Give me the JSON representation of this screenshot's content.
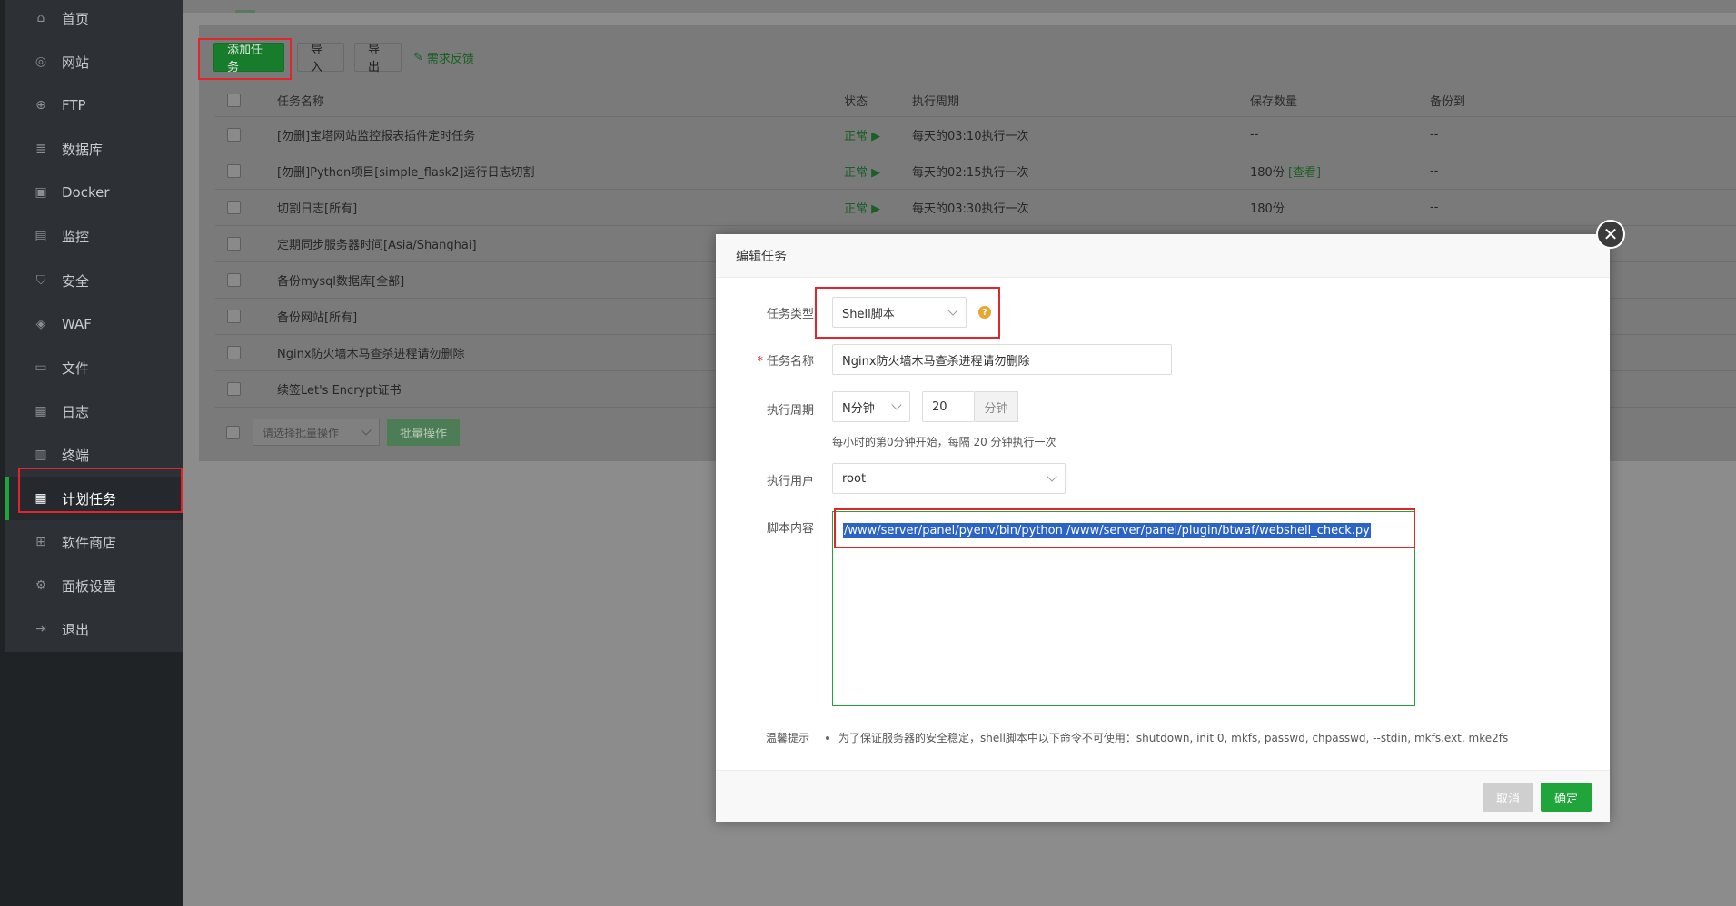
{
  "sidebar": {
    "items": [
      {
        "label": "首页",
        "icon": "home-icon"
      },
      {
        "label": "网站",
        "icon": "globe-icon"
      },
      {
        "label": "FTP",
        "icon": "ftp-icon"
      },
      {
        "label": "数据库",
        "icon": "database-icon"
      },
      {
        "label": "Docker",
        "icon": "docker-icon"
      },
      {
        "label": "监控",
        "icon": "monitor-icon"
      },
      {
        "label": "安全",
        "icon": "shield-icon"
      },
      {
        "label": "WAF",
        "icon": "waf-icon"
      },
      {
        "label": "文件",
        "icon": "folder-icon"
      },
      {
        "label": "日志",
        "icon": "log-icon"
      },
      {
        "label": "终端",
        "icon": "terminal-icon"
      },
      {
        "label": "计划任务",
        "icon": "calendar-icon"
      },
      {
        "label": "软件商店",
        "icon": "store-icon"
      },
      {
        "label": "面板设置",
        "icon": "gear-icon"
      },
      {
        "label": "退出",
        "icon": "logout-icon"
      }
    ],
    "active_index": 11
  },
  "toolbar": {
    "add_task": "添加任务",
    "import": "导入",
    "export": "导出",
    "feedback": "需求反馈"
  },
  "table": {
    "headers": {
      "name": "任务名称",
      "status": "状态",
      "cycle": "执行周期",
      "keep": "保存数量",
      "backup": "备份到"
    },
    "rows": [
      {
        "name": "[勿删]宝塔网站监控报表插件定时任务",
        "status": "正常 ▶",
        "cycle": "每天的03:10执行一次",
        "keep": "--",
        "backup": "--"
      },
      {
        "name": "[勿删]Python项目[simple_flask2]运行日志切割",
        "status": "正常 ▶",
        "cycle": "每天的02:15执行一次",
        "keep": "180份",
        "keep_link": "[查看]",
        "backup": "--"
      },
      {
        "name": "切割日志[所有]",
        "status": "正常 ▶",
        "cycle": "每天的03:30执行一次",
        "keep": "180份",
        "backup": "--"
      },
      {
        "name": "定期同步服务器时间[Asia/Shanghai]"
      },
      {
        "name": "备份mysql数据库[全部]"
      },
      {
        "name": "备份网站[所有]"
      },
      {
        "name": "Nginx防火墙木马查杀进程请勿删除"
      },
      {
        "name": "续签Let's Encrypt证书"
      }
    ],
    "batch_placeholder": "请选择批量操作",
    "batch_button": "批量操作"
  },
  "modal": {
    "title": "编辑任务",
    "task_type_label": "任务类型",
    "task_type_value": "Shell脚本",
    "task_name_label": "任务名称",
    "task_name_value": "Nginx防火墙木马查杀进程请勿删除",
    "cycle_label": "执行周期",
    "cycle_type_value": "N分钟",
    "cycle_minutes_value": "20",
    "cycle_unit": "分钟",
    "cycle_hint": "每小时的第0分钟开始，每隔 20 分钟执行一次",
    "user_label": "执行用户",
    "user_value": "root",
    "script_label": "脚本内容",
    "script_value": "/www/server/panel/pyenv/bin/python /www/server/panel/plugin/btwaf/webshell_check.py",
    "tips_label": "温馨提示",
    "tips_text": "为了保证服务器的安全稳定，shell脚本中以下命令不可使用：shutdown, init 0, mkfs, passwd, chpasswd, --stdin, mkfs.ext, mke2fs",
    "cancel": "取消",
    "confirm": "确定"
  },
  "colors": {
    "accent": "#20a53a",
    "highlight": "#e0262c",
    "selection": "#2b63c6"
  }
}
